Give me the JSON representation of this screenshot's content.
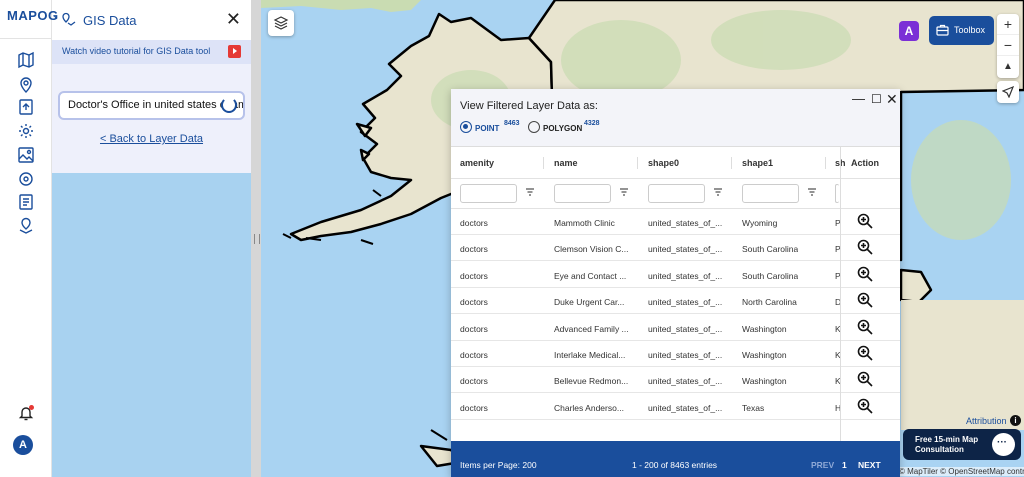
{
  "app": {
    "logo_text": "MAPOG",
    "avatar_initial": "A"
  },
  "panel": {
    "title": "GIS Data",
    "tutorial_text": "Watch video tutorial for GIS Data tool",
    "search_value": "Doctor's Office in united states of america",
    "back_link": "< Back to Layer Data"
  },
  "map": {
    "toolbox_label": "Toolbox",
    "zoom_in": "+",
    "zoom_out": "−",
    "attribution_label": "Attribution",
    "consult_line1": "Free 15-min Map",
    "consult_line2": "Consultation",
    "credits": "© MapTiler © OpenStreetMap contributors"
  },
  "data_window": {
    "title": "View Filtered Layer Data as:",
    "point_label": "POINT",
    "point_count": "8463",
    "polygon_label": "POLYGON",
    "polygon_count": "4328",
    "selected": "POINT",
    "columns": [
      "amenity",
      "name",
      "shape0",
      "shape1",
      "sh",
      "Action"
    ],
    "rows": [
      {
        "amenity": "doctors",
        "name": "Mammoth Clinic",
        "shape0": "united_states_of_...",
        "shape1": "Wyoming",
        "shape2": "P"
      },
      {
        "amenity": "doctors",
        "name": "Clemson Vision C...",
        "shape0": "united_states_of_...",
        "shape1": "South Carolina",
        "shape2": "P"
      },
      {
        "amenity": "doctors",
        "name": "Eye and Contact ...",
        "shape0": "united_states_of_...",
        "shape1": "South Carolina",
        "shape2": "P"
      },
      {
        "amenity": "doctors",
        "name": "Duke Urgent Car...",
        "shape0": "united_states_of_...",
        "shape1": "North Carolina",
        "shape2": "D"
      },
      {
        "amenity": "doctors",
        "name": "Advanced Family ...",
        "shape0": "united_states_of_...",
        "shape1": "Washington",
        "shape2": "K"
      },
      {
        "amenity": "doctors",
        "name": "Interlake Medical...",
        "shape0": "united_states_of_...",
        "shape1": "Washington",
        "shape2": "K"
      },
      {
        "amenity": "doctors",
        "name": "Bellevue Redmon...",
        "shape0": "united_states_of_...",
        "shape1": "Washington",
        "shape2": "K"
      },
      {
        "amenity": "doctors",
        "name": "Charles Anderso...",
        "shape0": "united_states_of_...",
        "shape1": "Texas",
        "shape2": "H"
      }
    ],
    "footer": {
      "items_per_page": "Items per Page: 200",
      "range": "1 - 200 of 8463 entries",
      "prev": "PREV",
      "page": "1",
      "next": "NEXT"
    }
  },
  "colors": {
    "brand": "#1a4e9c",
    "accent": "#f0a500",
    "ai": "#7b2fd6",
    "consult_bg": "#0d2447",
    "water": "#a9d3f2",
    "land": "#e8e4cf"
  },
  "icons": [
    "map-icon",
    "location-pin-icon",
    "upload-icon",
    "gear-icon",
    "gallery-icon",
    "settings-icon",
    "list-icon",
    "user-location-icon",
    "bell-icon",
    "layers-icon",
    "toolbox-icon",
    "compass-icon",
    "navigate-icon",
    "filter-icon",
    "zoom-in-icon",
    "chat-icon",
    "youtube-icon"
  ]
}
